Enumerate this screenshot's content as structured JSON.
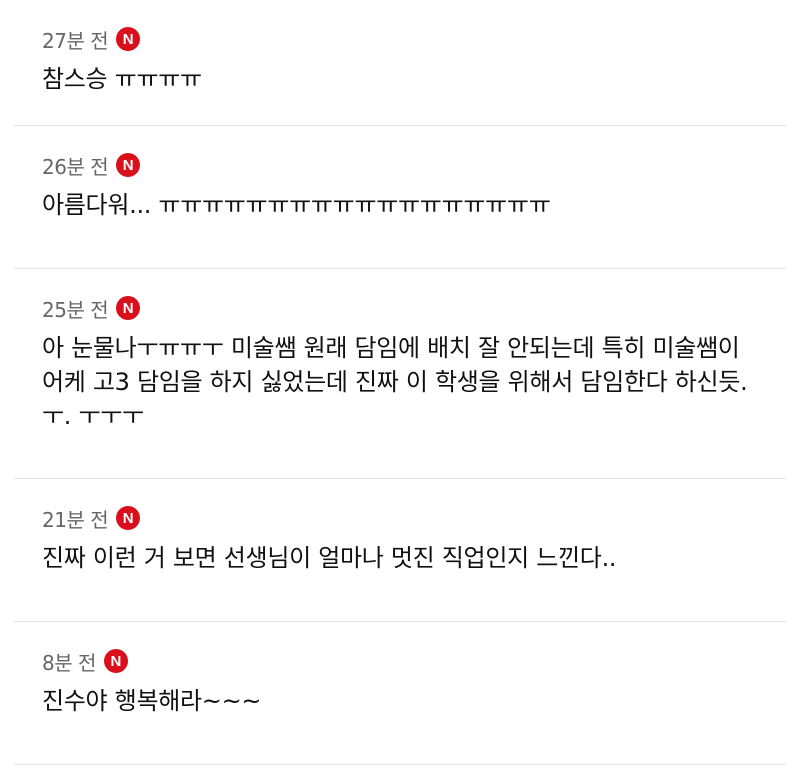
{
  "comments": [
    {
      "time": "27분 전",
      "badge": "N",
      "text": "참스승 ㅠㅠㅠㅠ"
    },
    {
      "time": "26분 전",
      "badge": "N",
      "text": "아름다워... ㅠㅠㅠㅠㅠㅠㅠㅠㅠㅠㅠㅠㅠㅠㅠㅠㅠㅠ"
    },
    {
      "time": "25분 전",
      "badge": "N",
      "text": "아 눈물나ㅜㅠㅠㅜ 미술쌤 원래 담임에 배치 잘 안되는데 특히 미술쌤이 어케 고3 담임을 하지 싫었는데 진짜 이 학생을 위해서 담임한다 하신듯. ㅜ. ㅜㅜㅜ"
    },
    {
      "time": "21분 전",
      "badge": "N",
      "text": "진짜 이런 거 보면 선생님이 얼마나 멋진 직업인지 느낀다.."
    },
    {
      "time": "8분 전",
      "badge": "N",
      "text": "진수야 행복해라~~~"
    }
  ]
}
